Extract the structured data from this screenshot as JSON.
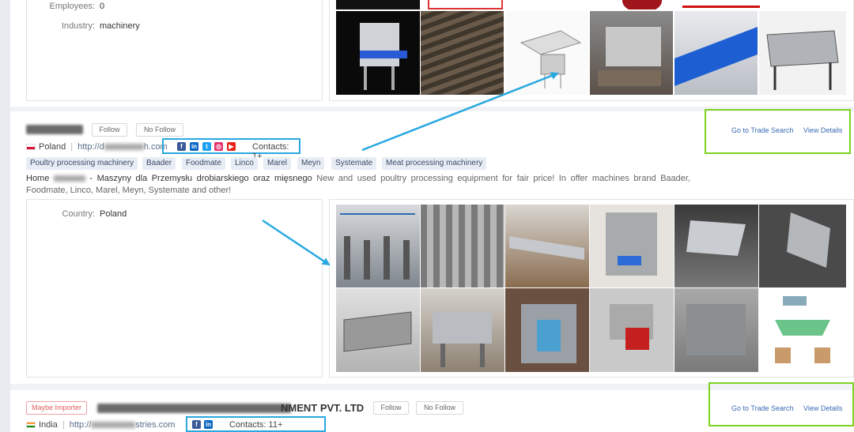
{
  "company1": {
    "employees_label": "Employees:",
    "employees_value": "0",
    "industry_label": "Industry:",
    "industry_value": "machinery"
  },
  "company2": {
    "follow_label": "Follow",
    "no_follow_label": "No Follow",
    "country": "Poland",
    "url_prefix": "http://d",
    "url_suffix": "h.com",
    "contacts": "Contacts:  1+",
    "tags": [
      "Poultry processing machinery",
      "Baader",
      "Foodmate",
      "Linco",
      "Marel",
      "Meyn",
      "Systemate",
      "Meat processing machinery"
    ],
    "desc_home": "Home",
    "desc_polish": "- Maszyny dla Przemysłu drobiarskiego oraz mięsnego",
    "desc_english": "New and used poultry processing equipment for fair price! In offer machines brand Baader, Foodmate, Linco, Marel, Meyn, Systemate and other!",
    "country_label": "Country:",
    "country_value": "Poland",
    "trade_search_label": "Go to Trade Search",
    "view_details_label": "View Details"
  },
  "company3": {
    "badge": "Maybe Importer",
    "name_tail": "NMENT PVT. LTD",
    "follow_label": "Follow",
    "no_follow_label": "No Follow",
    "country": "India",
    "url_prefix": "http://",
    "url_suffix": "stries.com",
    "contacts": "Contacts:  11+",
    "trade_search_label": "Go to Trade Search",
    "view_details_label": "View Details"
  },
  "colors": {
    "annotation_blue": "#29a8e0",
    "annotation_green": "#7ed321",
    "link_blue": "#3a6cb5"
  }
}
